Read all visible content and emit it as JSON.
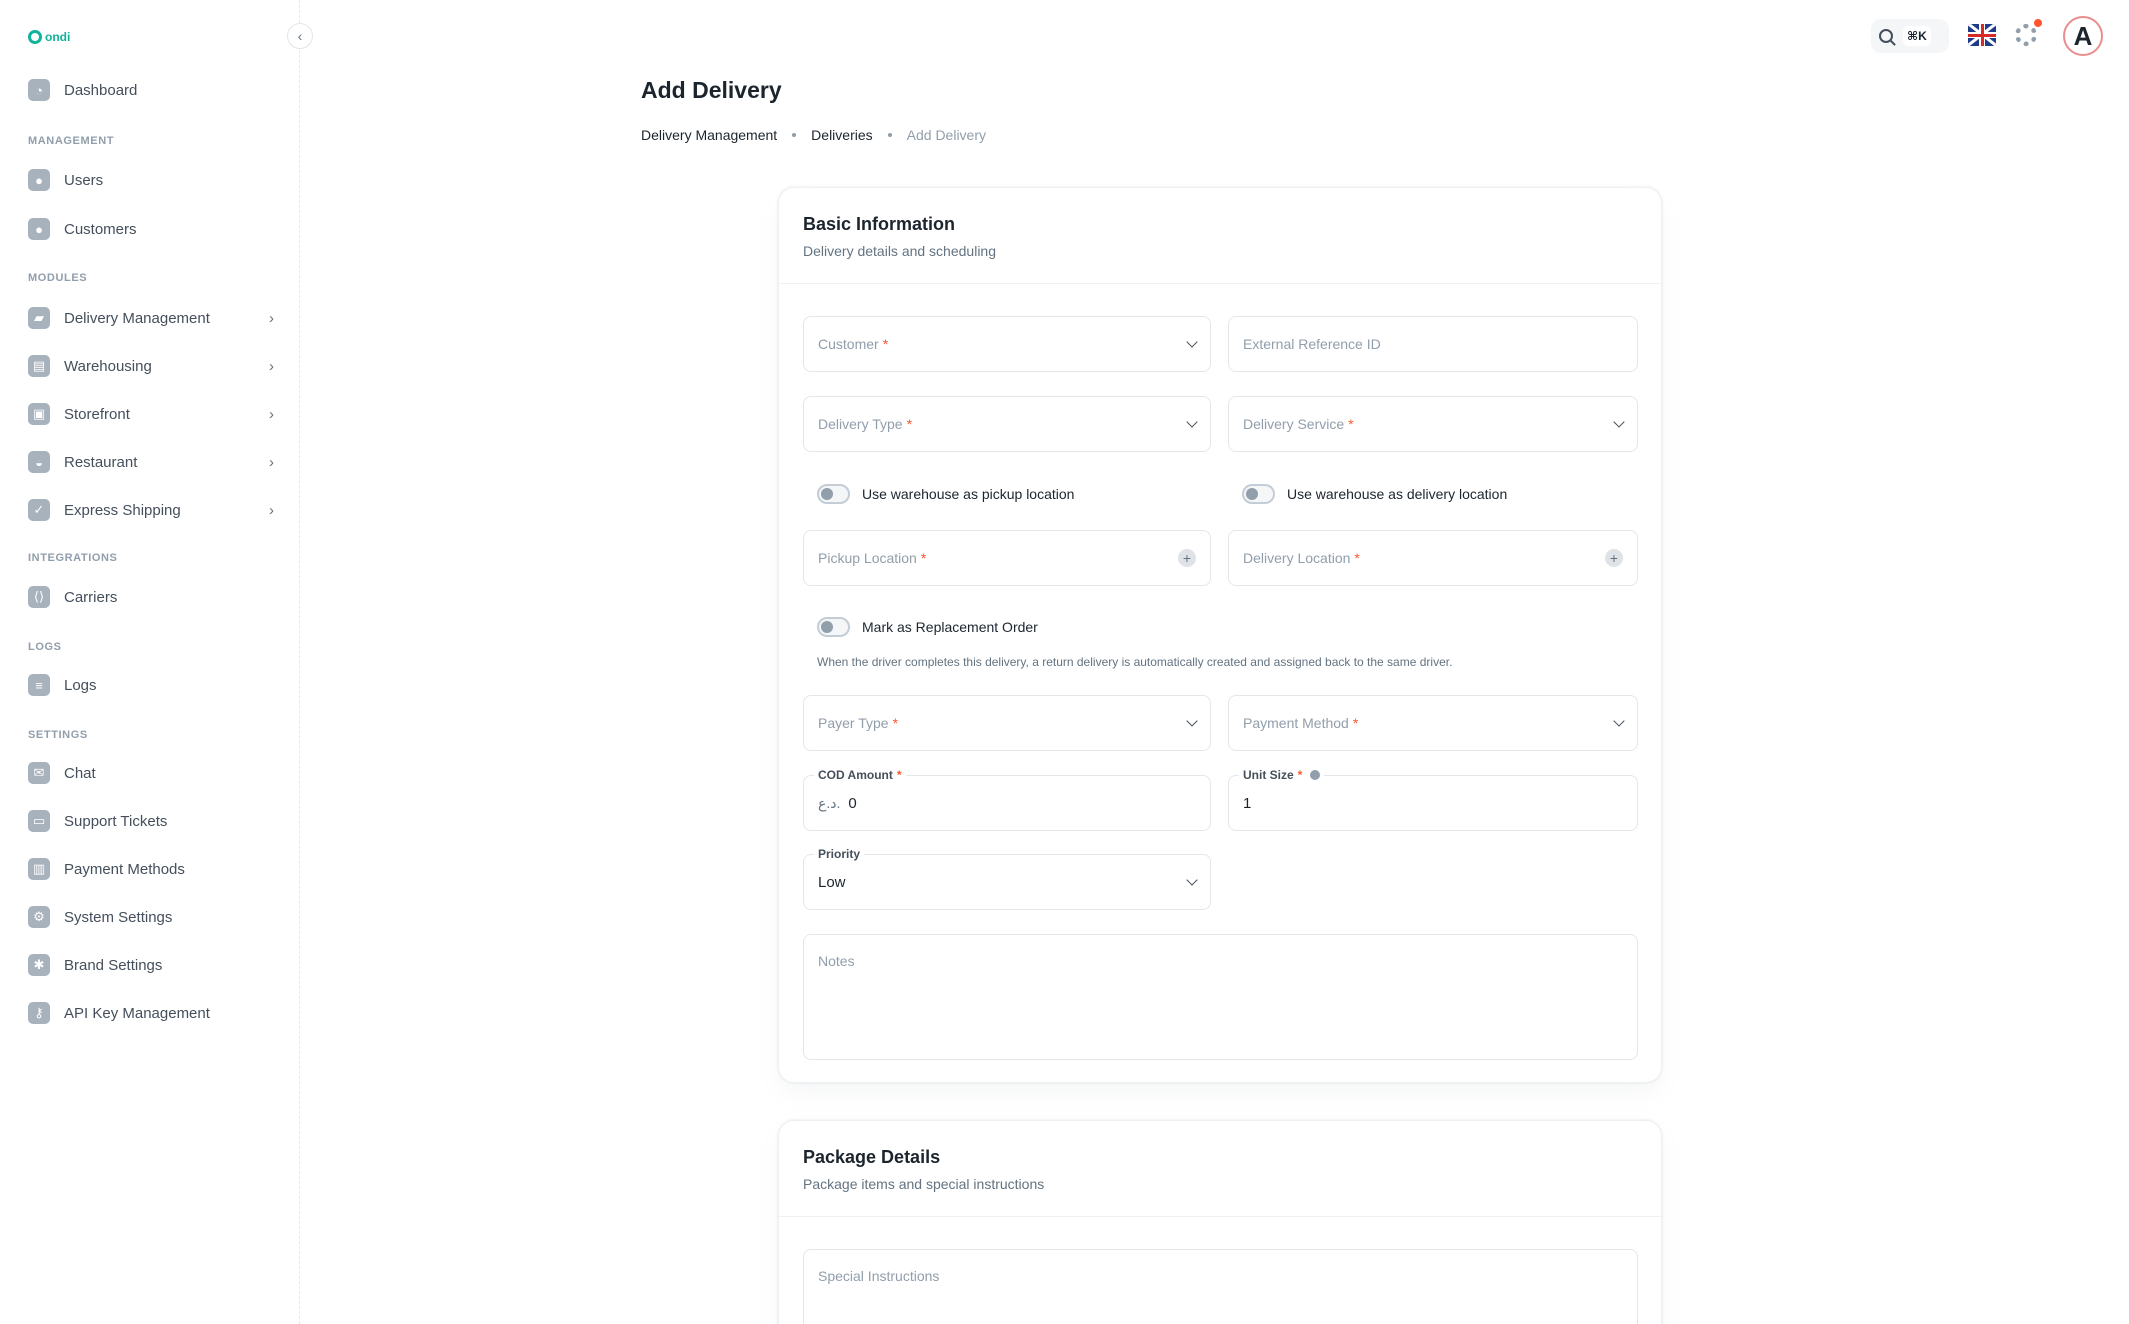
{
  "brand": {
    "logo_text": "ondi"
  },
  "sidebar": {
    "dashboard": "Dashboard",
    "sections": {
      "management": "MANAGEMENT",
      "modules": "MODULES",
      "integrations": "INTEGRATIONS",
      "logs": "LOGS",
      "settings": "SETTINGS"
    },
    "items": {
      "users": "Users",
      "customers": "Customers",
      "delivery_management": "Delivery Management",
      "warehousing": "Warehousing",
      "storefront": "Storefront",
      "restaurant": "Restaurant",
      "express_shipping": "Express Shipping",
      "carriers": "Carriers",
      "logs": "Logs",
      "chat": "Chat",
      "support_tickets": "Support Tickets",
      "payment_methods": "Payment Methods",
      "system_settings": "System Settings",
      "brand_settings": "Brand Settings",
      "api_key_management": "API Key Management"
    }
  },
  "topbar": {
    "shortcut": "⌘K",
    "avatar_letter": "A"
  },
  "page": {
    "title": "Add Delivery",
    "breadcrumb": [
      "Delivery Management",
      "Deliveries",
      "Add Delivery"
    ]
  },
  "basic_info": {
    "title": "Basic Information",
    "subtitle": "Delivery details and scheduling",
    "customer": "Customer",
    "external_ref": "External Reference ID",
    "delivery_type": "Delivery Type",
    "delivery_service": "Delivery Service",
    "toggle_pickup": "Use warehouse as pickup location",
    "toggle_delivery": "Use warehouse as delivery location",
    "pickup_location": "Pickup Location",
    "delivery_location": "Delivery Location",
    "toggle_replacement": "Mark as Replacement Order",
    "replacement_help": "When the driver completes this delivery, a return delivery is automatically created and assigned back to the same driver.",
    "payer_type": "Payer Type",
    "payment_method": "Payment Method",
    "cod_amount_label": "COD Amount",
    "cod_currency": "د.ع.",
    "cod_amount_value": "0",
    "unit_size_label": "Unit Size",
    "unit_size_value": "1",
    "priority_label": "Priority",
    "priority_value": "Low",
    "notes": "Notes",
    "required_mark": "*"
  },
  "package": {
    "title": "Package Details",
    "subtitle": "Package items and special instructions",
    "special_instructions": "Special Instructions"
  }
}
